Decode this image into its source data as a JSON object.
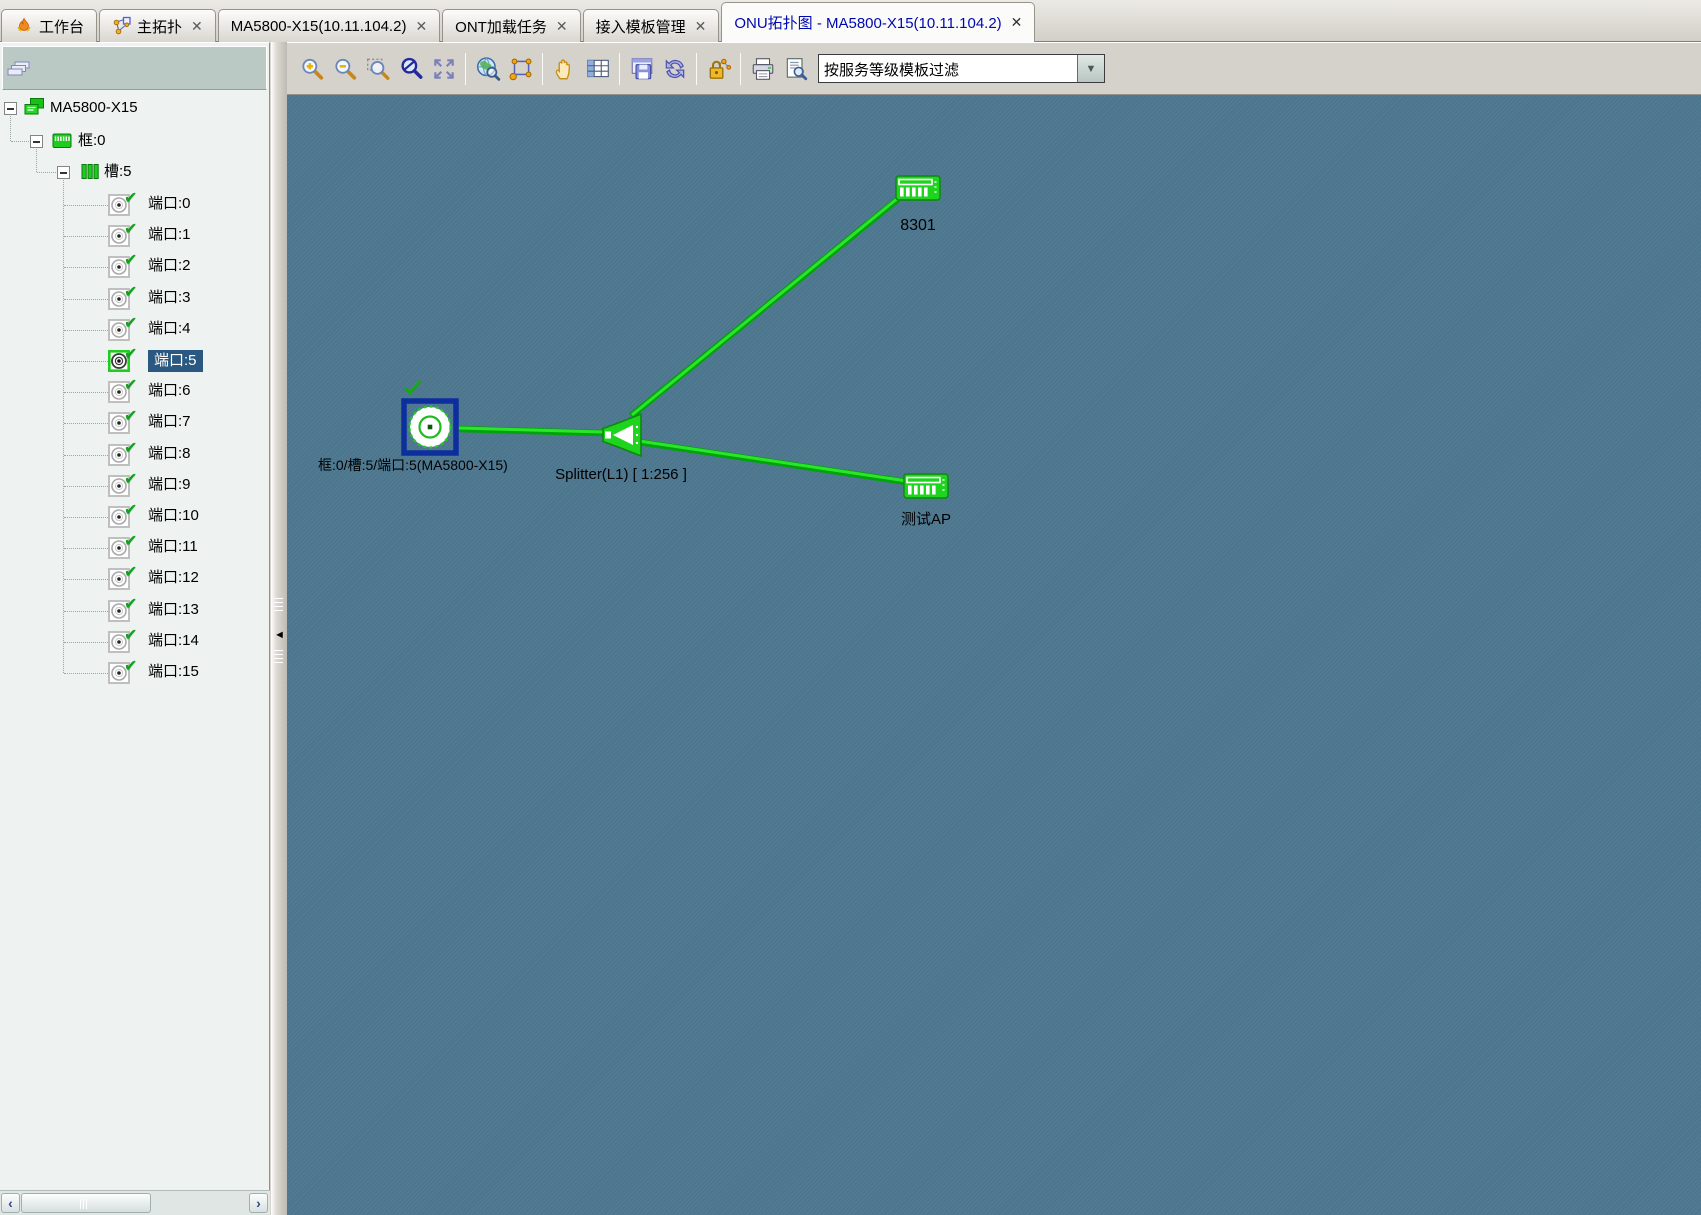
{
  "tabs": [
    {
      "name": "workbench",
      "label": "工作台",
      "icon": "workbench",
      "closable": false,
      "active": false
    },
    {
      "name": "main-topology",
      "label": "主拓扑",
      "icon": "main-topo",
      "closable": true,
      "active": false
    },
    {
      "name": "device",
      "label": "MA5800-X15(10.11.104.2)",
      "icon": "",
      "closable": true,
      "active": false
    },
    {
      "name": "ont-load-task",
      "label": "ONT加载任务",
      "icon": "",
      "closable": true,
      "active": false
    },
    {
      "name": "access-template-mgmt",
      "label": "接入模板管理",
      "icon": "",
      "closable": true,
      "active": false
    },
    {
      "name": "onu-topology",
      "label": "ONU拓扑图 - MA5800-X15(10.11.104.2)",
      "icon": "",
      "closable": true,
      "active": true
    }
  ],
  "toolbar": {
    "groups": [
      [
        "zoom-in",
        "zoom-out",
        "zoom-marquee",
        "zoom-reset",
        "fit-view"
      ],
      [
        "overview-globe",
        "layout-frame"
      ],
      [
        "pan-hand",
        "data-table"
      ],
      [
        "save-topology",
        "refresh"
      ],
      [
        "lock-topology"
      ],
      [
        "print",
        "print-preview"
      ]
    ],
    "filter_dropdown": {
      "value": "按服务等级模板过滤"
    }
  },
  "tree": {
    "root": {
      "label": "MA5800-X15"
    },
    "frame": {
      "label": "框:0"
    },
    "slot": {
      "label": "槽:5"
    },
    "ports": {
      "labels": [
        "端口:0",
        "端口:1",
        "端口:2",
        "端口:3",
        "端口:4",
        "端口:5",
        "端口:6",
        "端口:7",
        "端口:8",
        "端口:9",
        "端口:10",
        "端口:11",
        "端口:12",
        "端口:13",
        "端口:14",
        "端口:15"
      ],
      "selected_index": 5
    }
  },
  "topology": {
    "olt_port": {
      "label": "框:0/槽:5/端口:5(MA5800-X15)",
      "status": "selected"
    },
    "splitter": {
      "label": "Splitter(L1) [ 1:256 ]"
    },
    "onus": [
      {
        "label": "8301"
      },
      {
        "label": "测试AP"
      }
    ]
  },
  "icons": {
    "close": "✕",
    "check": "✔",
    "scroll_left": "‹",
    "scroll_right": "›",
    "dropdown": "▼",
    "collapse_left": "◄"
  },
  "colors": {
    "accent_green": "#1fd41f",
    "canvas_bg": "#4e7991",
    "selection_bg": "#2a5880",
    "active_tab_text": "#0008b0",
    "node_border_blue": "#0d2f9e"
  }
}
